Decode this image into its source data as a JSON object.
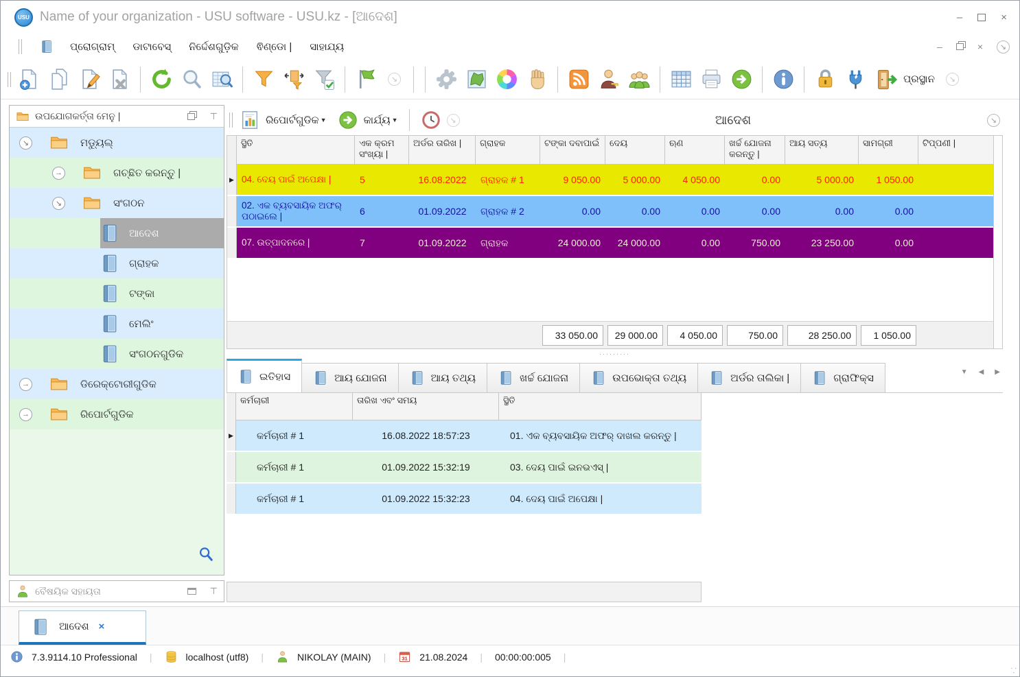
{
  "window": {
    "title": "Name of your organization - USU software - USU.kz - [ଆଦେଶ]",
    "logo_text": "USU",
    "controls": {
      "minimize": "–",
      "maximize": "",
      "close": "×"
    }
  },
  "menu": {
    "items": [
      {
        "label": "ପ୍ରୋଗ୍ରାମ୍"
      },
      {
        "label": "ଡାଟାବେସ୍"
      },
      {
        "label": "ନିର୍ଦ୍ଦେଶଗୁଡ଼ିକ"
      },
      {
        "label": "ଵିଣ୍ଡୋ |"
      },
      {
        "label": "ସାହାଯ୍ୟ"
      }
    ]
  },
  "toolbar": {
    "exit_label": "ପ୍ରସ୍ଥାନ"
  },
  "sidebar": {
    "header": "ଉପଯୋଗକର୍ତ୍ତା ମେନୁ |",
    "tree": [
      {
        "label": "ମଡ୍ୟୁଲ୍",
        "type": "folder",
        "level": 0,
        "expand": "open"
      },
      {
        "label": "ଗଚ୍ଛିତ କରନ୍ତୁ |",
        "type": "folder",
        "level": 1,
        "expand": "closed"
      },
      {
        "label": "ସଂଗଠନ",
        "type": "folder",
        "level": 1,
        "expand": "open"
      },
      {
        "label": "ଆଦେଶ",
        "type": "book",
        "level": 2,
        "selected": true
      },
      {
        "label": "ଗ୍ରାହକ",
        "type": "book",
        "level": 2
      },
      {
        "label": "ଟଙ୍କା",
        "type": "book",
        "level": 2
      },
      {
        "label": "ମେଲିଂ",
        "type": "book",
        "level": 2
      },
      {
        "label": "ସଂଗଠନଗୁଡିକ",
        "type": "book",
        "level": 2
      },
      {
        "label": "ଡିରେକ୍ଟୋରୀଗୁଡିକ",
        "type": "folder",
        "level": 0,
        "expand": "closed"
      },
      {
        "label": "ରିପୋର୍ଟଗୁଡିକ",
        "type": "folder",
        "level": 0,
        "expand": "closed"
      }
    ],
    "support_label": "ବୈଷୟିକ ସହାୟତା"
  },
  "content": {
    "toolbar": {
      "reports_label": "ରିପୋର୍ଟଗୁଡିକ",
      "actions_label": "କାର୍ଯ୍ୟ",
      "title": "ଆଦେଶ"
    },
    "orders_table": {
      "columns": [
        "ସ୍ଥିତି",
        "ଏକ କ୍ରମ ସଂଖ୍ୟା |",
        "ଅର୍ଡର ତାରିଖ |",
        "ଗ୍ରାହକ",
        "ଟଙ୍କା ଦବାପାଇଁ",
        "ଦେୟ",
        "ଋଣ",
        "ଖର୍ଚ୍ଚ ଯୋଜନା କରନ୍ତୁ |",
        "ଆୟ ସତ୍ୟ",
        "ସାମଗ୍ରୀ",
        "ଟିପ୍ପଣୀ |"
      ],
      "rows": [
        {
          "current": true,
          "bg": "#e8e800",
          "fg": "#ff2400",
          "cells": [
            "04. ଦେୟ ପାଇଁ ଅପେକ୍ଷା |",
            "5",
            "16.08.2022",
            "ଗ୍ରାହକ # 1",
            "9 050.00",
            "5 000.00",
            "4 050.00",
            "0.00",
            "5 000.00",
            "1 050.00",
            ""
          ]
        },
        {
          "current": false,
          "bg": "#80c0fa",
          "fg": "#12129e",
          "cells": [
            "02. ଏକ ବ୍ୟବସାୟିକ ଅଫର୍ ପଠାଇଲେ |",
            "6",
            "01.09.2022",
            "ଗ୍ରାହକ # 2",
            "0.00",
            "0.00",
            "0.00",
            "0.00",
            "0.00",
            "0.00",
            ""
          ]
        },
        {
          "current": false,
          "bg": "#800080",
          "fg": "#f2ead8",
          "cells": [
            "07. ଉତ୍ପାଦନରେ |",
            "7",
            "01.09.2022",
            "ଗ୍ରାହକ",
            "24 000.00",
            "24 000.00",
            "0.00",
            "750.00",
            "23 250.00",
            "0.00",
            ""
          ]
        }
      ],
      "totals": [
        "33 050.00",
        "29 000.00",
        "4 050.00",
        "750.00",
        "28 250.00",
        "1 050.00"
      ]
    },
    "tabs": [
      {
        "label": "ଇତିହାସ",
        "active": true
      },
      {
        "label": "ଆୟ ଯୋଜନା"
      },
      {
        "label": "ଆୟ ତଥ୍ୟ"
      },
      {
        "label": "ଖର୍ଚ୍ଚ ଯୋଜନା"
      },
      {
        "label": "ଉପଭୋକ୍ତା ତଥ୍ୟ"
      },
      {
        "label": "ଅର୍ଡର ତାଲିକା |"
      },
      {
        "label": "ଗ୍ରାଫିକ୍ସ"
      }
    ],
    "history_table": {
      "columns": [
        "କର୍ମଚାରୀ",
        "ତାରିଖ ଏବଂ ସମୟ",
        "ସ୍ଥିତି"
      ],
      "rows": [
        {
          "current": true,
          "bg": "#cfe9fd",
          "cells": [
            "କର୍ମଚାରୀ # 1",
            "16.08.2022 18:57:23",
            "01. ଏକ ବ୍ୟବସାୟିକ ଅଫର୍ ଦାଖଲ କରନ୍ତୁ |"
          ]
        },
        {
          "current": false,
          "bg": "#dff4df",
          "cells": [
            "କର୍ମଚାରୀ # 1",
            "01.09.2022 15:32:19",
            "03. ଦେୟ ପାଇଁ ଇନଭଏସ୍ |"
          ]
        },
        {
          "current": false,
          "bg": "#cfe9fd",
          "cells": [
            "କର୍ମଚାରୀ # 1",
            "01.09.2022 15:32:23",
            "04. ଦେୟ ପାଇଁ ଅପେକ୍ଷା |"
          ]
        }
      ]
    }
  },
  "page_tab": {
    "label": "ଆଦେଶ",
    "close": "×"
  },
  "status_bar": {
    "version": "7.3.9114.10 Professional",
    "host": "localhost (utf8)",
    "user": "NIKOLAY (MAIN)",
    "calendar_day": "31",
    "date": "21.08.2024",
    "timer": "00:00:00:005"
  },
  "colors": {
    "accent_blue": "#2da7df",
    "row_yellow": "#e8e800",
    "row_blue": "#80c0fa",
    "row_purple": "#800080",
    "tree_blue": "#daedff",
    "tree_green": "#ddf6dd"
  }
}
